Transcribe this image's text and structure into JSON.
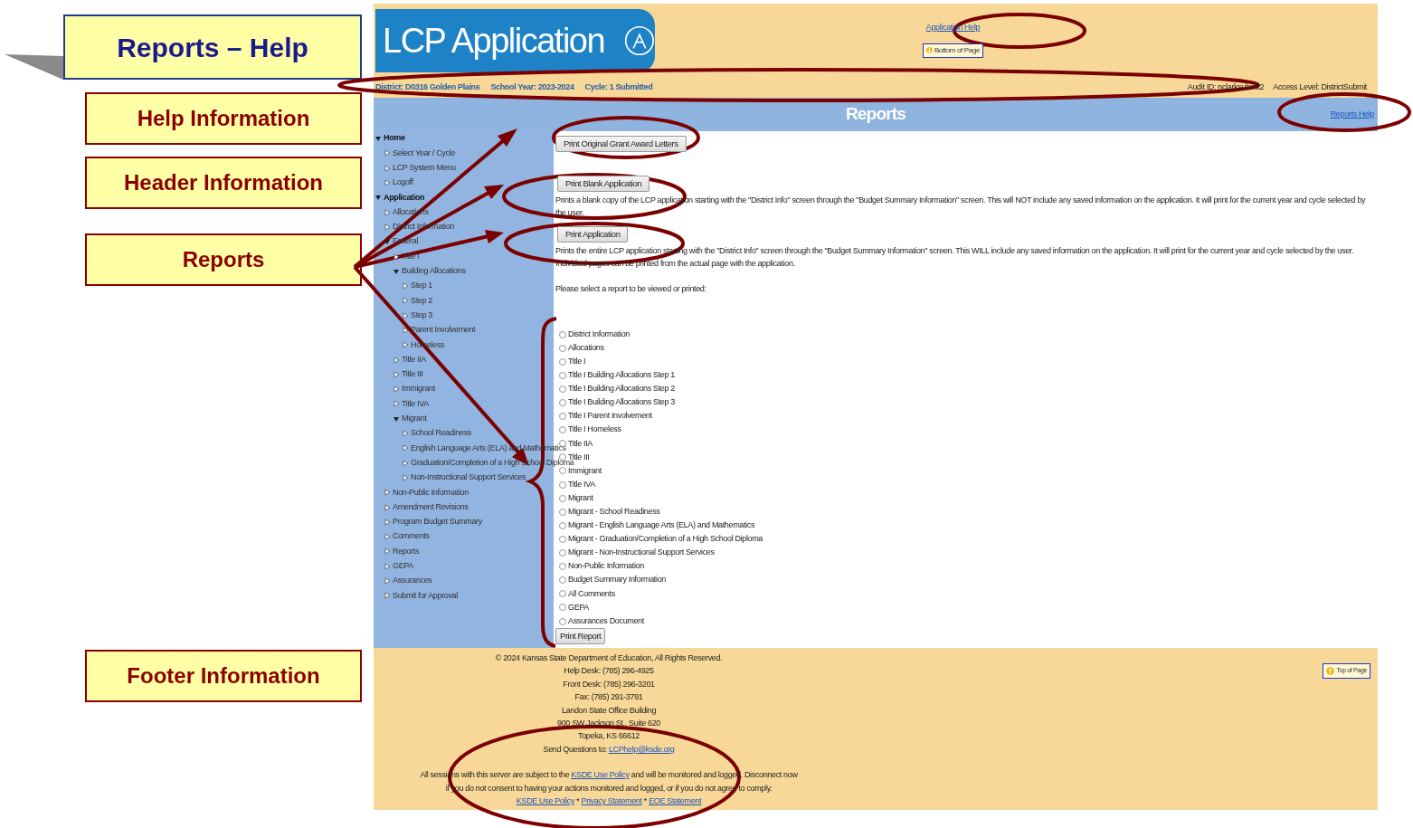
{
  "slide": {
    "title": "Reports – Help",
    "callouts": [
      {
        "label": "Help Information"
      },
      {
        "label": "Header Information"
      },
      {
        "label": "Reports"
      },
      {
        "label": "Footer Information"
      }
    ]
  },
  "header": {
    "logo_text": "LCP Application",
    "help_link": "Application Help",
    "bottom_link": "Bottom of Page",
    "info_left": [
      "District: D0316 Golden Plains",
      "School Year: 2023-2024",
      "Cycle: 1 Submitted"
    ],
    "info_right": [
      "Audit ID:  nclarksubmit2",
      "Access Level:  DistrictSubmit"
    ]
  },
  "title_bar": {
    "title": "Reports",
    "help_link": "Reports Help"
  },
  "sidebar": {
    "items": [
      {
        "label": "Home",
        "expanded": true,
        "children": [
          {
            "label": "Select Year / Cycle"
          },
          {
            "label": "LCP System Menu"
          },
          {
            "label": "Logoff"
          }
        ]
      },
      {
        "label": "Application",
        "expanded": true,
        "children": [
          {
            "label": "Allocations"
          },
          {
            "label": "District Information"
          },
          {
            "label": "Federal",
            "expanded": true,
            "children": [
              {
                "label": "Title I"
              },
              {
                "label": "Building Allocations",
                "expanded": true,
                "children": [
                  {
                    "label": "Step 1"
                  },
                  {
                    "label": "Step 2"
                  },
                  {
                    "label": "Step 3"
                  },
                  {
                    "label": "Parent Involvement"
                  },
                  {
                    "label": "Homeless"
                  }
                ]
              },
              {
                "label": "Title IIA"
              },
              {
                "label": "Title III"
              },
              {
                "label": "Immigrant"
              },
              {
                "label": "Title IVA"
              },
              {
                "label": "Migrant",
                "expanded": true,
                "children": [
                  {
                    "label": "School Readiness"
                  },
                  {
                    "label": "English Language Arts (ELA) and Mathematics"
                  },
                  {
                    "label": "Graduation/Completion of a High School Diploma"
                  },
                  {
                    "label": "Non-Instructional Support Services"
                  }
                ]
              }
            ]
          },
          {
            "label": "Non-Public Information"
          },
          {
            "label": "Amendment Revisions"
          },
          {
            "label": "Program Budget Summary"
          },
          {
            "label": "Comments"
          },
          {
            "label": "Reports"
          },
          {
            "label": "GEPA"
          },
          {
            "label": "Assurances"
          },
          {
            "label": "Submit for Approval"
          }
        ]
      }
    ]
  },
  "main": {
    "actions": [
      {
        "button": "Print Original Grant Award  Letters"
      },
      {
        "button": "Print  Blank Application",
        "description": "Prints a blank copy of the LCP application starting with the \"District Info\" screen through the \"Budget Summary Information\" screen. This will NOT include any saved information on the application. It will print for the current year and cycle selected by the user."
      },
      {
        "button": "Print Application",
        "description": "Prints the entire LCP application starting with the \"District Info\" screen through the \"Budget Summary Information\" screen. This WILL include any saved information on the application. It will print for the current year and cycle selected by the user. Individual pages can be printed from the actual page with the application."
      }
    ],
    "prompt": "Please select a report to be viewed or printed:",
    "reports": [
      {
        "label": "District Information",
        "selected": false
      },
      {
        "label": "Allocations",
        "selected": false
      },
      {
        "label": "Title I",
        "selected": false
      },
      {
        "label": "Title I Building Allocations Step 1",
        "selected": false
      },
      {
        "label": "Title I Building Allocations Step 2",
        "selected": false
      },
      {
        "label": "Title I Building Allocations Step 3",
        "selected": false
      },
      {
        "label": "Title I Parent Involvement",
        "selected": false
      },
      {
        "label": "Title I Homeless",
        "selected": false
      },
      {
        "label": "Title IIA",
        "selected": false
      },
      {
        "label": "Title III",
        "selected": false
      },
      {
        "label": "Immigrant",
        "selected": false
      },
      {
        "label": "Title IVA",
        "selected": false
      },
      {
        "label": "Migrant",
        "selected": false
      },
      {
        "label": "Migrant - School Readiness",
        "selected": false
      },
      {
        "label": "Migrant - English Language Arts (ELA) and Mathematics",
        "selected": false
      },
      {
        "label": "Migrant - Graduation/Completion of a High School Diploma",
        "selected": false
      },
      {
        "label": "Migrant - Non-Instructional Support Services",
        "selected": false
      },
      {
        "label": "Non-Public Information",
        "selected": false
      },
      {
        "label": "Budget Summary Information",
        "selected": false
      },
      {
        "label": "All Comments",
        "selected": false
      },
      {
        "label": "GEPA",
        "selected": false
      },
      {
        "label": "Assurances Document",
        "selected": false
      }
    ],
    "print_button": "Print Report"
  },
  "footer": {
    "lines": [
      "© 2024 Kansas State Department of Education, All Rights Reserved.",
      "Help Desk: (785) 296-4925",
      "Front Desk: (785) 296-3201",
      "Fax: (785) 291-3791",
      "Landon State Office Building",
      "900 SW Jackson St., Suite 620",
      "Topeka, KS 66612"
    ],
    "questions_label": "Send Questions to:",
    "questions_email": "LCPhelp@ksde.org",
    "notice_before": "All sessions with this server are subject to the",
    "notice_link": "KSDE Use Policy",
    "notice_after": "and will be monitored and logged. Disconnect now if you do not consent to having your actions monitored and logged, or if you do not agree to comply.",
    "links": [
      "KSDE Use Policy",
      "Privacy Statement",
      "EOE Statement"
    ],
    "separator": "*",
    "top_link": "Top of Page"
  }
}
